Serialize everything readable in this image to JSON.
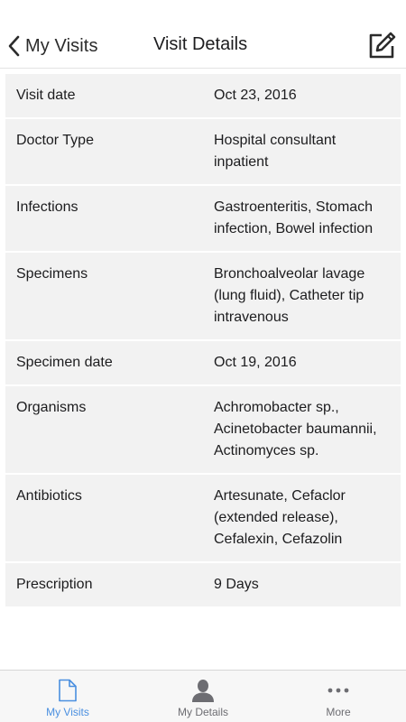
{
  "navbar": {
    "back_label": "My Visits",
    "title": "Visit Details",
    "back_icon": "chevron-left-icon",
    "edit_icon": "edit-icon"
  },
  "details": [
    {
      "label": "Visit date",
      "value": "Oct 23, 2016"
    },
    {
      "label": "Doctor Type",
      "value": "Hospital consultant inpatient"
    },
    {
      "label": "Infections",
      "value": "Gastroenteritis, Stomach infection, Bowel infection"
    },
    {
      "label": "Specimens",
      "value": "Bronchoalveolar lavage (lung fluid), Catheter tip intravenous"
    },
    {
      "label": "Specimen date",
      "value": "Oct 19, 2016"
    },
    {
      "label": "Organisms",
      "value": "Achromobacter sp., Acinetobacter baumannii, Actinomyces sp."
    },
    {
      "label": "Antibiotics",
      "value": "Artesunate, Cefaclor (extended release), Cefalexin, Cefazolin"
    },
    {
      "label": "Prescription",
      "value": "9 Days"
    }
  ],
  "tabbar": {
    "tabs": [
      {
        "label": "My Visits",
        "icon": "document-icon",
        "active": true
      },
      {
        "label": "My Details",
        "icon": "person-icon",
        "active": false
      },
      {
        "label": "More",
        "icon": "more-icon",
        "active": false
      }
    ]
  },
  "colors": {
    "accent": "#4a8fe0",
    "row_background": "#f2f2f2",
    "tab_inactive": "#6d6d72"
  }
}
